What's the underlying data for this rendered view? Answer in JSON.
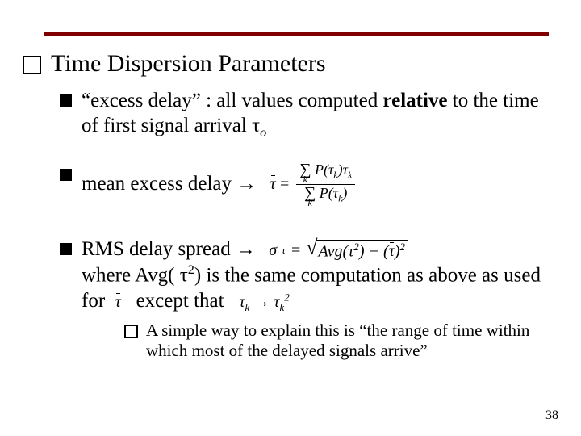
{
  "heading": "Time Dispersion Parameters",
  "bullets": {
    "excess_pre": "“excess delay” : all values computed ",
    "excess_bold": "relative",
    "excess_post": " to the time of first signal arrival τ",
    "excess_sub": "o",
    "mean": "mean excess delay →",
    "rms_line": "RMS delay spread →",
    "rms_where_a": "where Avg( τ",
    "rms_where_a_sup": "2",
    "rms_where_b": ") is the same computation as above as used for",
    "rms_where_c": "except that",
    "note": "A simple way to explain this is “the range of time within which most of the delayed signals arrive”"
  },
  "math": {
    "tau_bar": "τ",
    "eq": "=",
    "P": "P",
    "tau": "τ",
    "k": "k",
    "sigma_tau": "σ",
    "sigma_sub": "τ",
    "Avg": "Avg",
    "minus": "−",
    "arrow": "→",
    "sq": "2"
  },
  "page": "38"
}
